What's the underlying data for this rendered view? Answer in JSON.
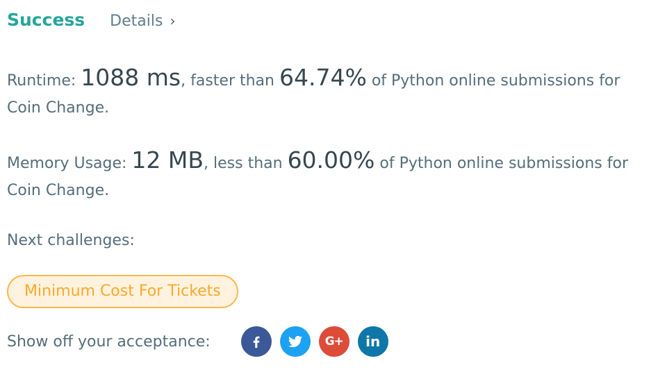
{
  "header": {
    "status": "Success",
    "details_label": "Details",
    "chevron": "›"
  },
  "runtime": {
    "label": "Runtime: ",
    "value": "1088 ms",
    "middle": ", faster than ",
    "percent": "64.74%",
    "tail": " of Python online submissions for",
    "problem": "Coin Change."
  },
  "memory": {
    "label": "Memory Usage: ",
    "value": "12 MB",
    "middle": ", less than ",
    "percent": "60.00%",
    "tail": " of Python online submissions for",
    "problem": "Coin Change."
  },
  "next": {
    "label": "Next challenges:",
    "challenges": [
      "Minimum Cost For Tickets"
    ]
  },
  "share": {
    "label": "Show off your acceptance:",
    "buttons": [
      {
        "icon": "facebook-icon",
        "color": "#3b5998"
      },
      {
        "icon": "twitter-icon",
        "color": "#1da1f2"
      },
      {
        "icon": "google-plus-icon",
        "glyph": "G+",
        "color": "#dd4b39"
      },
      {
        "icon": "linkedin-icon",
        "glyph": "in",
        "color": "#0e76a8"
      }
    ]
  },
  "colors": {
    "success": "#26a69a",
    "challenge_border": "#ffb74d",
    "challenge_bg": "#fff3e0",
    "challenge_text": "#ffa726"
  }
}
